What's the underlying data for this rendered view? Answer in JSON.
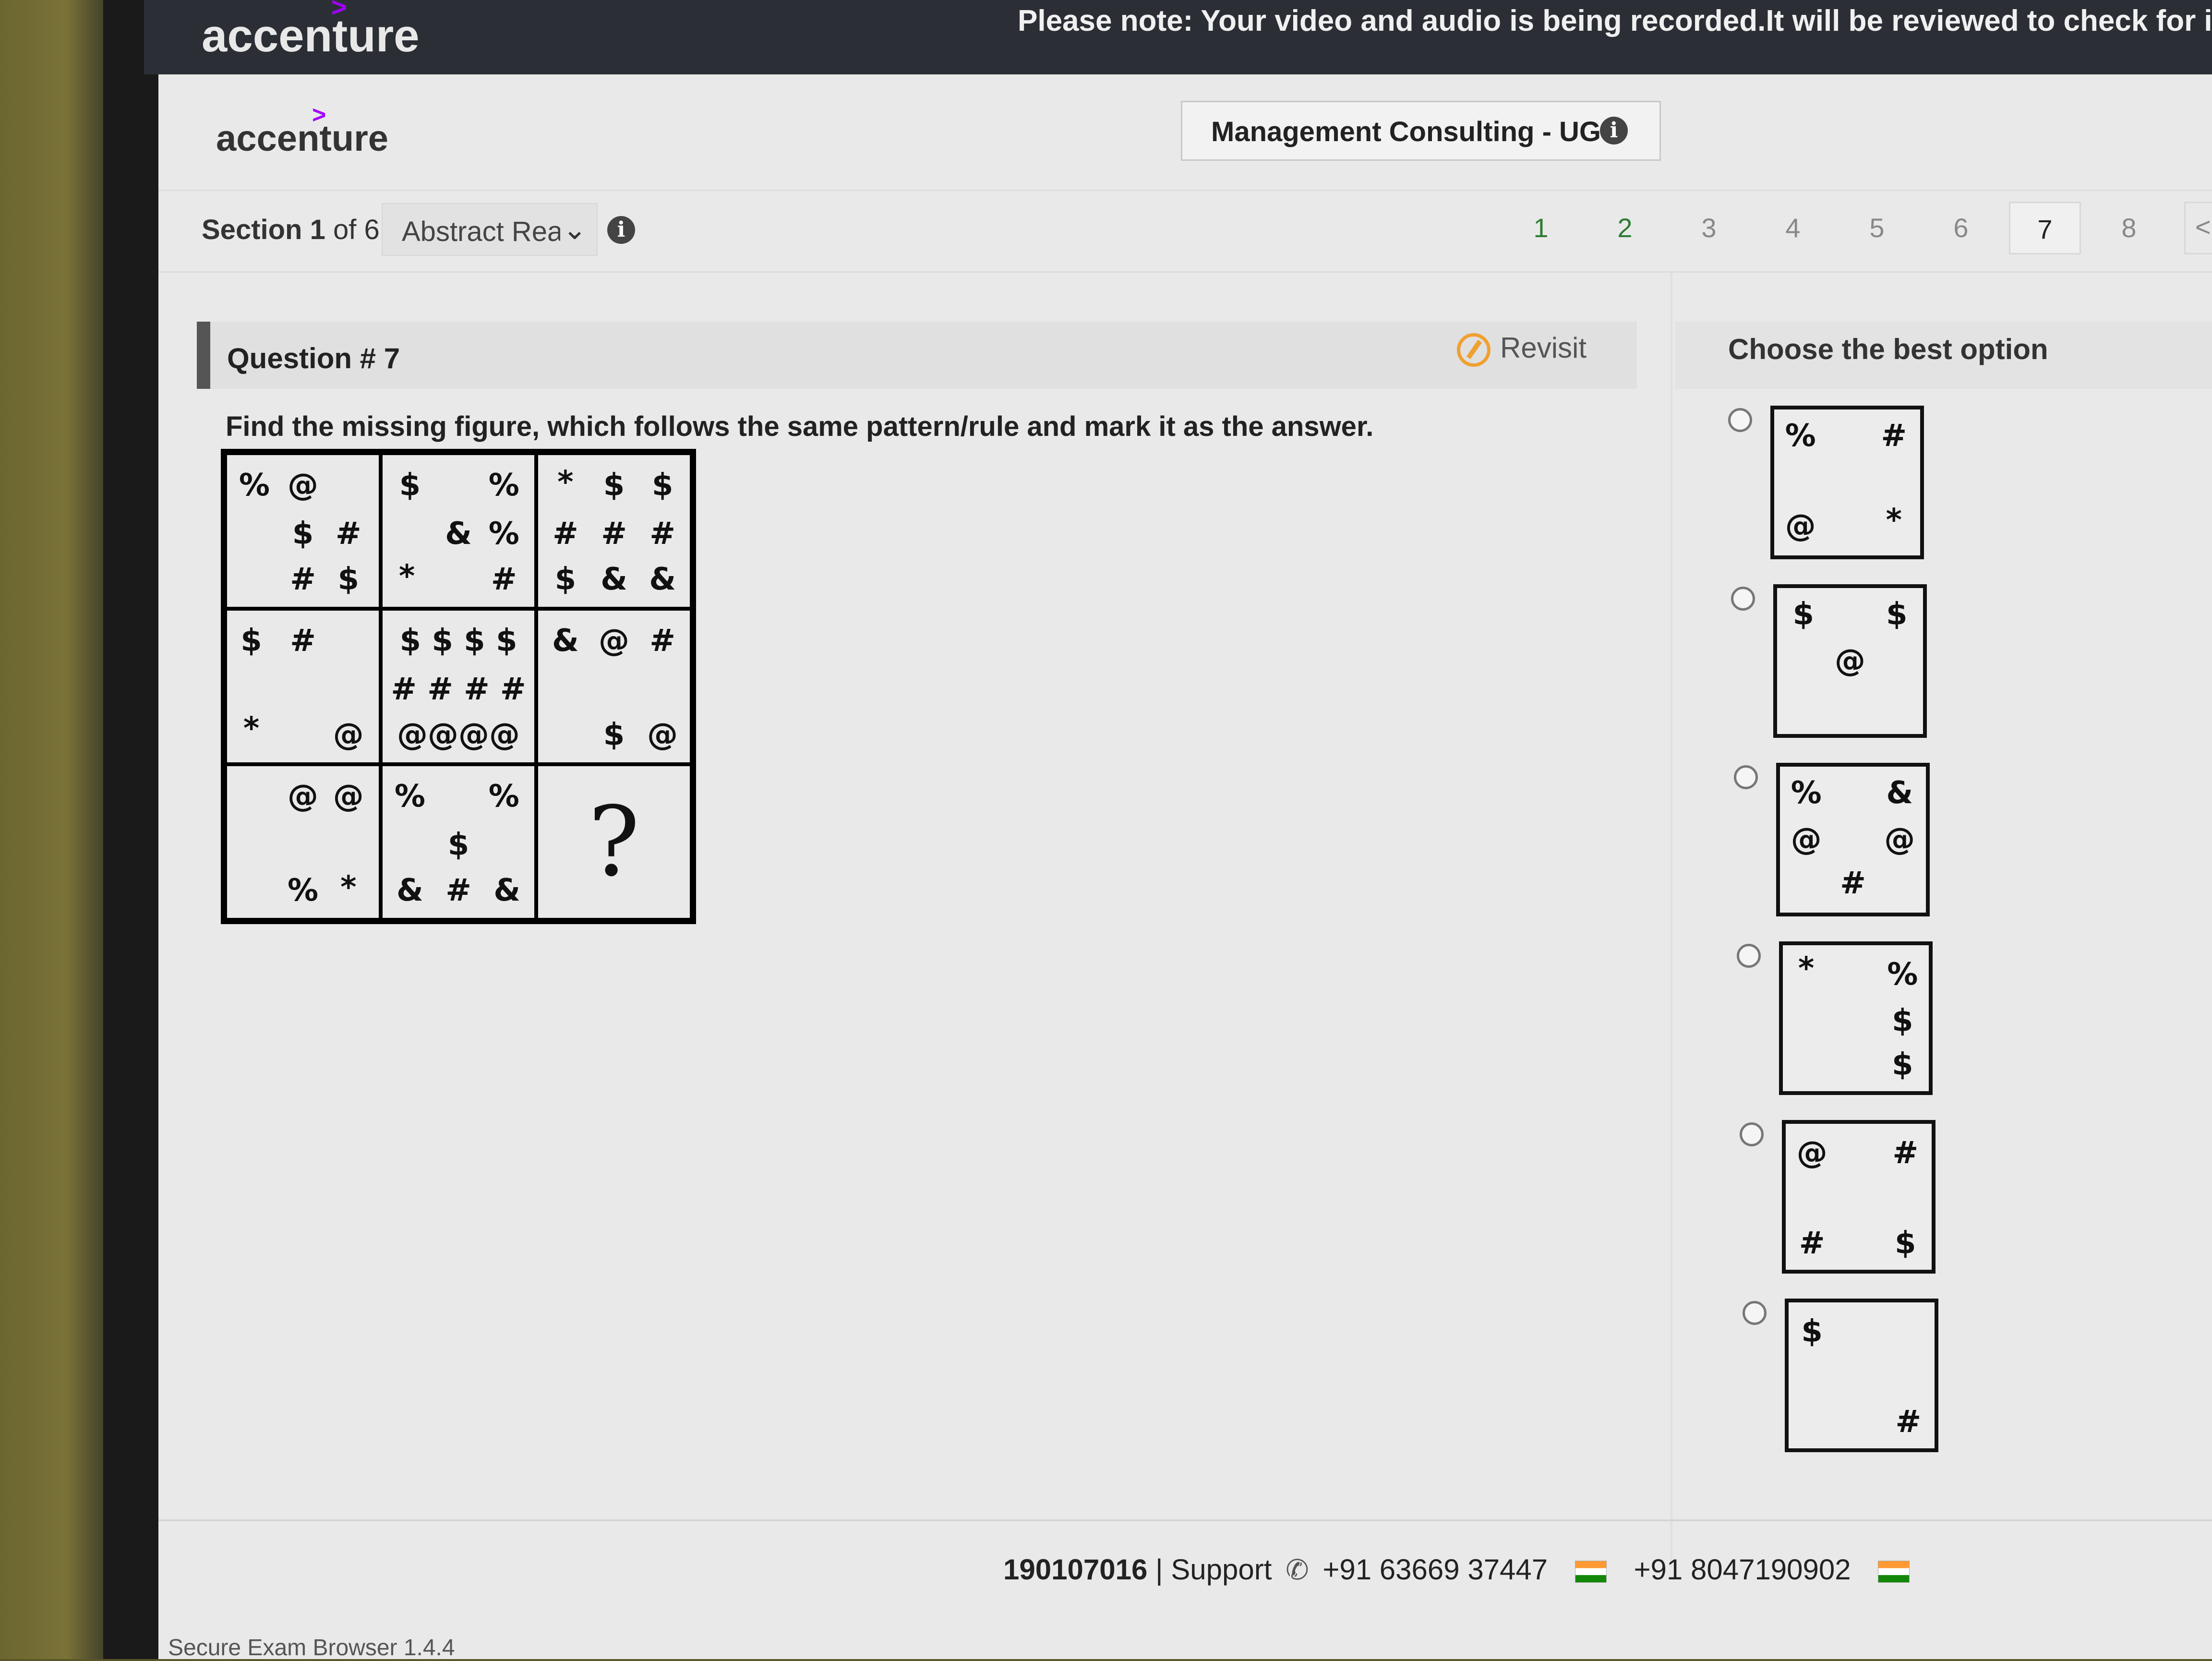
{
  "topbar": {
    "logo": "accenture",
    "note": "Please note: Your video and audio is being recorded.It will be reviewed to check for in"
  },
  "header": {
    "logo": "accenture",
    "course": "Management Consulting - UG",
    "info_icon": "i"
  },
  "section": {
    "label_prefix": "Section",
    "number": "1",
    "of_text": "of 6",
    "selected": "Abstract Rea",
    "chevron": "⌄"
  },
  "pager": {
    "pages": [
      "1",
      "2",
      "3",
      "4",
      "5",
      "6",
      "7",
      "8"
    ],
    "current": "7",
    "prev": "<"
  },
  "question": {
    "title": "Question # 7",
    "revisit_label": "Revisit",
    "prompt": "Find the missing figure, which follows the same pattern/rule and mark it as the answer.",
    "grid": [
      [
        {
          "t": "%",
          "x": 18,
          "y": 20
        },
        {
          "t": "@",
          "x": 50,
          "y": 20
        },
        {
          "t": "$",
          "x": 50,
          "y": 52
        },
        {
          "t": "#",
          "x": 80,
          "y": 52
        },
        {
          "t": "#",
          "x": 50,
          "y": 82
        },
        {
          "t": "$",
          "x": 80,
          "y": 82
        }
      ],
      [
        {
          "t": "$",
          "x": 18,
          "y": 20
        },
        {
          "t": "%",
          "x": 80,
          "y": 20
        },
        {
          "t": "&",
          "x": 50,
          "y": 52
        },
        {
          "t": "%",
          "x": 80,
          "y": 52
        },
        {
          "t": "*",
          "x": 16,
          "y": 80
        },
        {
          "t": "#",
          "x": 80,
          "y": 82
        }
      ],
      [
        {
          "t": "*",
          "x": 18,
          "y": 18
        },
        {
          "t": "$",
          "x": 50,
          "y": 20
        },
        {
          "t": "$",
          "x": 82,
          "y": 20
        },
        {
          "t": "#",
          "x": 18,
          "y": 52
        },
        {
          "t": "#",
          "x": 50,
          "y": 52
        },
        {
          "t": "#",
          "x": 82,
          "y": 52
        },
        {
          "t": "$",
          "x": 18,
          "y": 82
        },
        {
          "t": "&",
          "x": 50,
          "y": 82
        },
        {
          "t": "&",
          "x": 82,
          "y": 82
        }
      ],
      [
        {
          "t": "$",
          "x": 16,
          "y": 20
        },
        {
          "t": "#",
          "x": 50,
          "y": 20
        },
        {
          "t": "*",
          "x": 16,
          "y": 78
        },
        {
          "t": "@",
          "x": 80,
          "y": 82
        }
      ],
      [
        {
          "t": "$ $ $ $",
          "x": 50,
          "y": 20
        },
        {
          "t": "# # # #",
          "x": 50,
          "y": 52
        },
        {
          "t": "@@@@",
          "x": 50,
          "y": 82
        }
      ],
      [
        {
          "t": "&",
          "x": 18,
          "y": 20
        },
        {
          "t": "@",
          "x": 50,
          "y": 20
        },
        {
          "t": "#",
          "x": 82,
          "y": 20
        },
        {
          "t": "$",
          "x": 50,
          "y": 82
        },
        {
          "t": "@",
          "x": 82,
          "y": 82
        }
      ],
      [
        {
          "t": "@",
          "x": 50,
          "y": 20
        },
        {
          "t": "@",
          "x": 80,
          "y": 20
        },
        {
          "t": "%",
          "x": 50,
          "y": 82
        },
        {
          "t": "*",
          "x": 80,
          "y": 80
        }
      ],
      [
        {
          "t": "%",
          "x": 18,
          "y": 20
        },
        {
          "t": "%",
          "x": 80,
          "y": 20
        },
        {
          "t": "$",
          "x": 50,
          "y": 52
        },
        {
          "t": "&",
          "x": 18,
          "y": 82
        },
        {
          "t": "#",
          "x": 50,
          "y": 82
        },
        {
          "t": "&",
          "x": 82,
          "y": 82
        }
      ],
      [
        {
          "t": "?",
          "x": 50,
          "y": 50,
          "big": true
        }
      ]
    ]
  },
  "options_header": "Choose the best option",
  "options": [
    {
      "symbols": [
        {
          "t": "%",
          "x": 18,
          "y": 18
        },
        {
          "t": "#",
          "x": 82,
          "y": 18
        },
        {
          "t": "@",
          "x": 18,
          "y": 80
        },
        {
          "t": "*",
          "x": 82,
          "y": 76
        }
      ]
    },
    {
      "symbols": [
        {
          "t": "$",
          "x": 18,
          "y": 18
        },
        {
          "t": "$",
          "x": 82,
          "y": 18
        },
        {
          "t": "@",
          "x": 50,
          "y": 50
        }
      ]
    },
    {
      "symbols": [
        {
          "t": "%",
          "x": 18,
          "y": 18
        },
        {
          "t": "&",
          "x": 82,
          "y": 18
        },
        {
          "t": "@",
          "x": 18,
          "y": 50
        },
        {
          "t": "@",
          "x": 82,
          "y": 50
        },
        {
          "t": "#",
          "x": 50,
          "y": 80
        }
      ]
    },
    {
      "symbols": [
        {
          "t": "*",
          "x": 16,
          "y": 16
        },
        {
          "t": "%",
          "x": 82,
          "y": 20
        },
        {
          "t": "$",
          "x": 82,
          "y": 52
        },
        {
          "t": "$",
          "x": 82,
          "y": 82
        }
      ]
    },
    {
      "symbols": [
        {
          "t": "@",
          "x": 18,
          "y": 20
        },
        {
          "t": "#",
          "x": 82,
          "y": 20
        },
        {
          "t": "#",
          "x": 18,
          "y": 82
        },
        {
          "t": "$",
          "x": 82,
          "y": 82
        }
      ]
    },
    {
      "symbols": [
        {
          "t": "$",
          "x": 16,
          "y": 20
        },
        {
          "t": "#",
          "x": 82,
          "y": 82
        }
      ]
    }
  ],
  "footer": {
    "id": "190107016",
    "support": "| Support",
    "phone_icon": "✆",
    "phone1": "+91 63669 37447",
    "phone2": "+91 8047190902",
    "browser": "Secure Exam Browser 1.4.4"
  }
}
